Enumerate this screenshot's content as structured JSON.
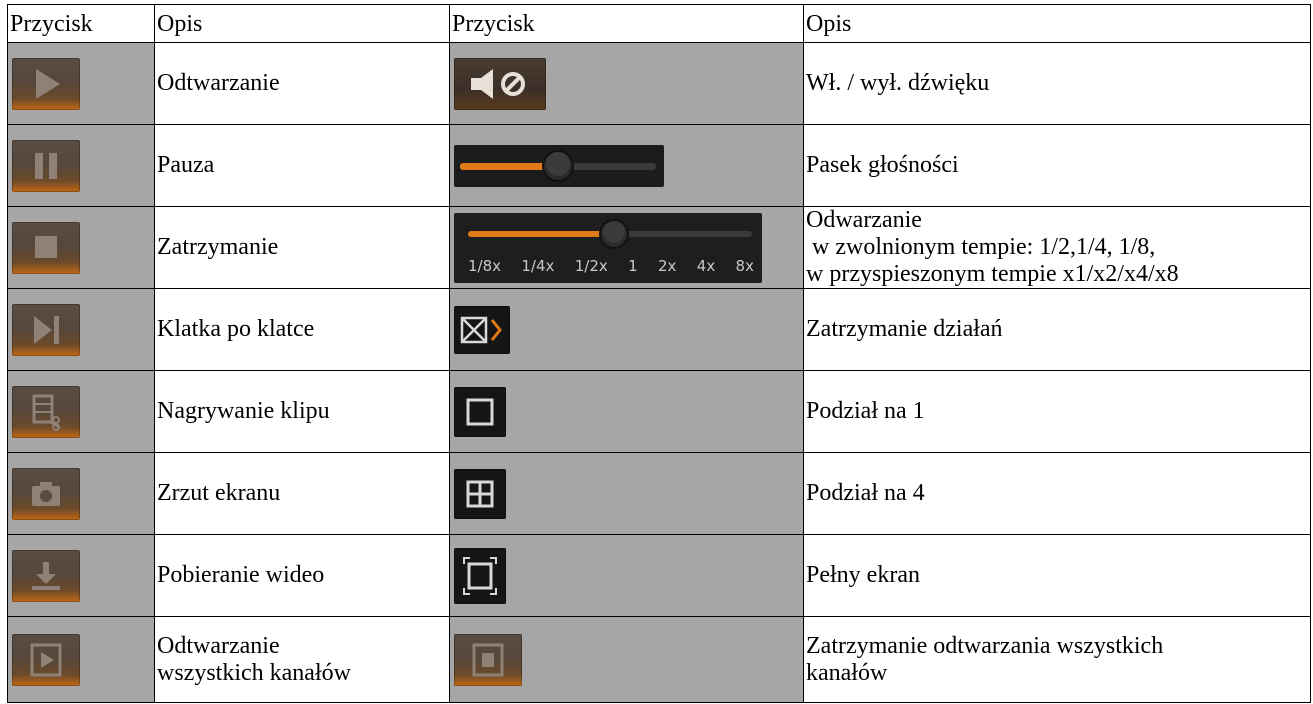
{
  "header": {
    "col1": "Przycisk",
    "col2": "Opis",
    "col3": "Przycisk",
    "col4": "Opis"
  },
  "rows": [
    {
      "left_icon": "play-icon",
      "left_desc": "Odtwarzanie",
      "right_icon": "mute-icon",
      "right_desc": "Wł. / wył. dźwięku"
    },
    {
      "left_icon": "pause-icon",
      "left_desc": "Pauza",
      "right_icon": "volume-slider",
      "right_desc": "Pasek głośności"
    },
    {
      "left_icon": "stop-icon",
      "left_desc": "Zatrzymanie",
      "right_icon": "speed-slider",
      "right_desc_lines": [
        "Odwarzanie",
        " w zwolnionym tempie: 1/2,1/4, 1/8,",
        "w przyspieszonym tempie x1/x2/x4/x8"
      ],
      "speed_labels": [
        "1/8x",
        "1/4x",
        "1/2x",
        "1",
        "2x",
        "4x",
        "8x"
      ]
    },
    {
      "left_icon": "frame-by-frame-icon",
      "left_desc": "Klatka po klatce",
      "right_icon": "stop-actions-icon",
      "right_desc": "Zatrzymanie działań"
    },
    {
      "left_icon": "clip-record-icon",
      "left_desc": "Nagrywanie klipu",
      "right_icon": "split-1-icon",
      "right_desc": "Podział na 1"
    },
    {
      "left_icon": "camera-icon",
      "left_desc": "Zrzut ekranu",
      "right_icon": "split-4-icon",
      "right_desc": "Podział na 4"
    },
    {
      "left_icon": "download-icon",
      "left_desc": "Pobieranie wideo",
      "right_icon": "fullscreen-icon",
      "right_desc": "Pełny ekran"
    },
    {
      "left_icon": "play-all-icon",
      "left_desc_lines": [
        "Odtwarzanie",
        "wszystkich kanałów"
      ],
      "right_icon": "stop-all-icon",
      "right_desc_lines": [
        "Zatrzymanie odtwarzania wszystkich",
        "kanałów"
      ]
    }
  ],
  "colors": {
    "icon_cell_bg": "#a6a6a6",
    "icon_body": "#8d7f74",
    "accent_orange": "#e07a16",
    "dark_bg": "#1c1c1c"
  }
}
